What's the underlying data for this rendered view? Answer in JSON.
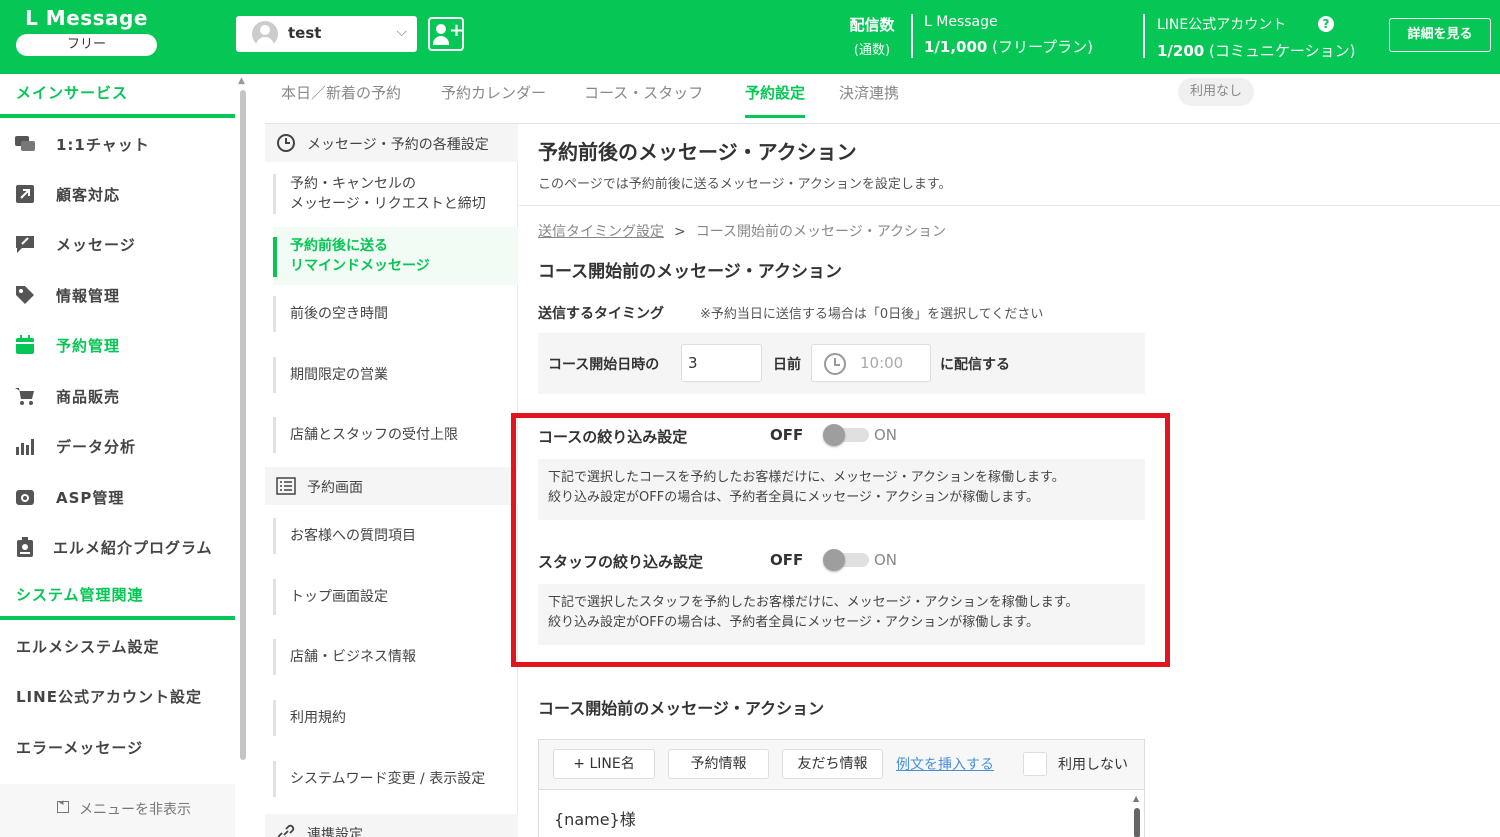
{
  "header": {
    "brand_name": "L Message",
    "plan_badge": "フリー",
    "account_name": "test",
    "delivery_label_1": "配信数",
    "delivery_label_2": "(通数)",
    "lmessage_title": "L Message",
    "lmessage_count": "1/1,000",
    "lmessage_plan": "(フリープラン)",
    "line_title": "LINE公式アカウント",
    "line_count": "1/200",
    "line_plan": "(コミュニケーション)",
    "detail_button": "詳細を見る"
  },
  "sidebar": {
    "main_section": "メインサービス",
    "items": [
      {
        "label": "1:1チャット",
        "icon": "chat-icon"
      },
      {
        "label": "顧客対応",
        "icon": "arrow-icon"
      },
      {
        "label": "メッセージ",
        "icon": "message-icon"
      },
      {
        "label": "情報管理",
        "icon": "tag-icon"
      },
      {
        "label": "予約管理",
        "icon": "calendar-icon"
      },
      {
        "label": "商品販売",
        "icon": "cart-icon"
      },
      {
        "label": "データ分析",
        "icon": "chart-icon"
      },
      {
        "label": "ASP管理",
        "icon": "asp-icon"
      },
      {
        "label": "エルメ紹介プログラム",
        "icon": "badge-icon"
      }
    ],
    "system_section": "システム管理関連",
    "system_items": [
      "エルメシステム設定",
      "LINE公式アカウント設定",
      "エラーメッセージ"
    ],
    "hide_menu": "メニューを非表示"
  },
  "tabs": [
    "本日／新着の予約",
    "予約カレンダー",
    "コース・スタッフ",
    "予約設定",
    "決済連携"
  ],
  "tab_badge": "利用なし",
  "subnav": {
    "group1": "メッセージ・予約の各種設定",
    "item1_line1": "予約・キャンセルの",
    "item1_line2": "メッセージ・リクエストと締切",
    "item2_line1": "予約前後に送る",
    "item2_line2": "リマインドメッセージ",
    "item3": "前後の空き時間",
    "item4": "期間限定の営業",
    "item5": "店舗とスタッフの受付上限",
    "group2": "予約画面",
    "item6": "お客様への質問項目",
    "item7": "トップ画面設定",
    "item8": "店舗・ビジネス情報",
    "item9": "利用規約",
    "item10": "システムワード変更 / 表示設定",
    "group3": "連携設定"
  },
  "main": {
    "title": "予約前後のメッセージ・アクション",
    "description": "このページでは予約前後に送るメッセージ・アクションを設定します。",
    "breadcrumb_link": "送信タイミング設定",
    "breadcrumb_sep": ">",
    "breadcrumb_current": "コース開始前のメッセージ・アクション",
    "section_title": "コース開始前のメッセージ・アクション",
    "timing_label": "送信するタイミング",
    "timing_note": "※予約当日に送信する場合は「0日後」を選択してください",
    "course_start_label": "コース開始日時の",
    "days_value": "3",
    "days_unit": "日前",
    "time_value": "10:00",
    "send_label": "に配信する",
    "course_filter_label": "コースの絞り込み設定",
    "course_filter_off": "OFF",
    "course_filter_on": "ON",
    "course_filter_desc1": "下記で選択したコースを予約したお客様だけに、メッセージ・アクションを稼働します。",
    "course_filter_desc2": "絞り込み設定がOFFの場合は、予約者全員にメッセージ・アクションが稼働します。",
    "staff_filter_label": "スタッフの絞り込み設定",
    "staff_filter_off": "OFF",
    "staff_filter_on": "ON",
    "staff_filter_desc1": "下記で選択したスタッフを予約したお客様だけに、メッセージ・アクションを稼働します。",
    "staff_filter_desc2": "絞り込み設定がOFFの場合は、予約者全員にメッセージ・アクションが稼働します。",
    "message_section_title": "コース開始前のメッセージ・アクション",
    "toolbar": {
      "line_name": "+ LINE名",
      "reservation_info": "予約情報",
      "friend_info": "友だち情報",
      "insert_example": "例文を挿入する",
      "not_use": "利用しない"
    },
    "editor_text": "{name}様"
  },
  "colors": {
    "brand": "#06c755",
    "highlight": "#e3141e"
  }
}
